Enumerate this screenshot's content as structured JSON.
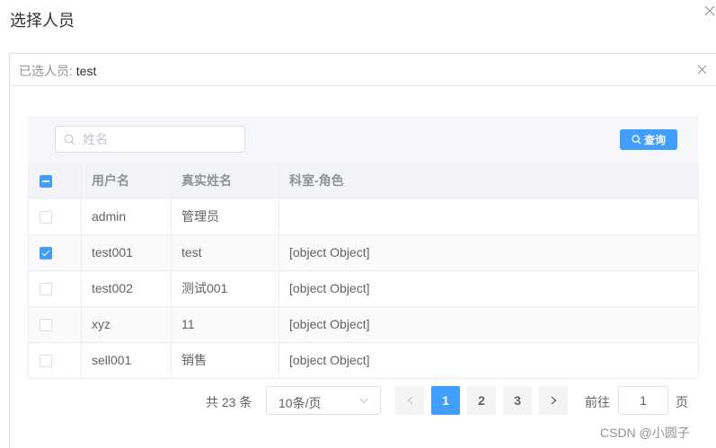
{
  "dialog": {
    "title": "选择人员"
  },
  "selected": {
    "label": "已选人员:",
    "value": "test"
  },
  "search": {
    "placeholder": "姓名",
    "value": "",
    "button_label": "查询"
  },
  "table": {
    "columns": [
      "用户名",
      "真实姓名",
      "科室-角色"
    ],
    "rows": [
      {
        "checked": false,
        "username": "admin",
        "realname": "管理员",
        "dept_role": ""
      },
      {
        "checked": true,
        "username": "test001",
        "realname": "test",
        "dept_role": "[object Object]"
      },
      {
        "checked": false,
        "username": "test002",
        "realname": "测试001",
        "dept_role": "[object Object]"
      },
      {
        "checked": false,
        "username": "xyz",
        "realname": "11",
        "dept_role": "[object Object]"
      },
      {
        "checked": false,
        "username": "sell001",
        "realname": "销售",
        "dept_role": "[object Object]"
      }
    ]
  },
  "pagination": {
    "total_text": "共 23 条",
    "page_size": "10条/页",
    "pages": [
      "1",
      "2",
      "3"
    ],
    "current_page": "1",
    "goto_label": "前往",
    "goto_value": "1",
    "page_unit": "页"
  },
  "watermark": "CSDN @小圆子",
  "colors": {
    "primary": "#409eff",
    "header_bg": "#f2f4f7",
    "strip_bg": "#f5f7fa"
  },
  "icons": {
    "close": "close-icon",
    "search": "search-icon",
    "prev": "chevron-left-icon",
    "next": "chevron-right-icon",
    "dropdown": "chevron-down-icon"
  }
}
